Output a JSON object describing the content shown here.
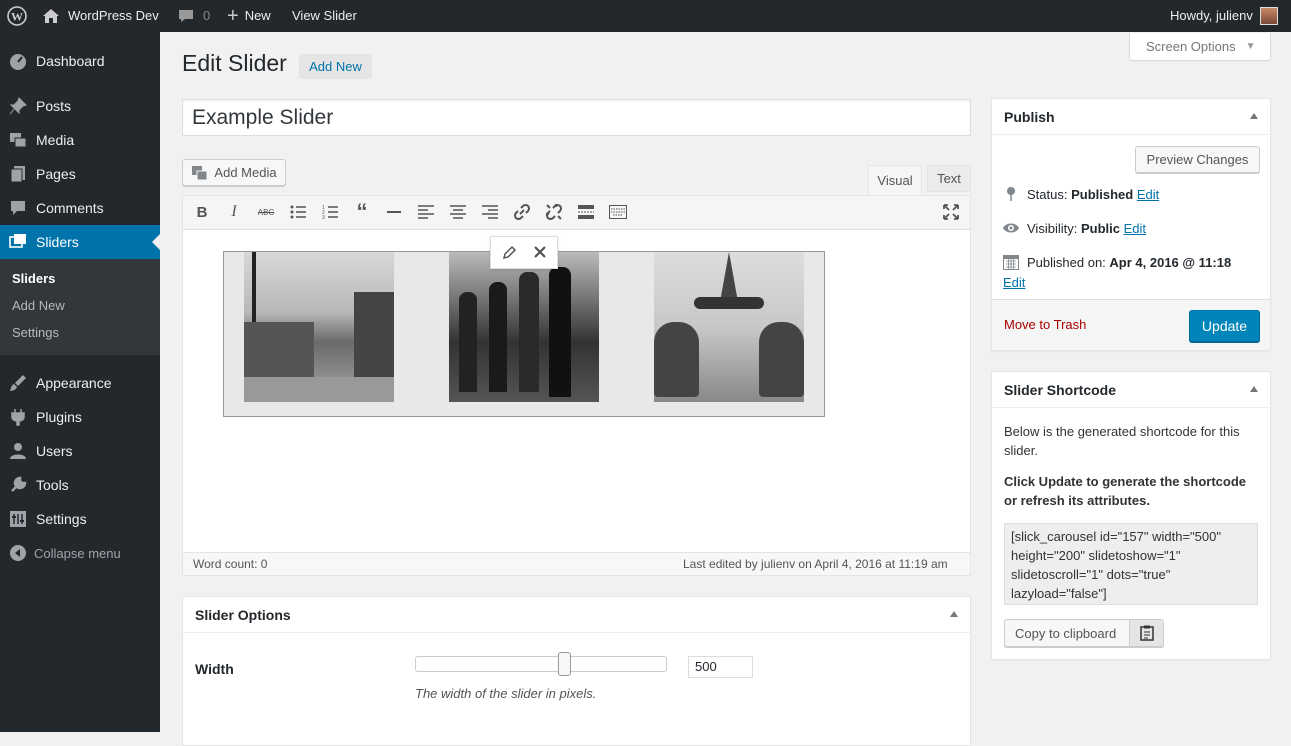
{
  "adminbar": {
    "site_name": "WordPress Dev",
    "comments_count": "0",
    "new_label": "New",
    "view_label": "View Slider",
    "howdy": "Howdy, julienv"
  },
  "sidebar": {
    "items": [
      {
        "label": "Dashboard",
        "icon": "dashboard-icon"
      },
      {
        "label": "Posts",
        "icon": "pin-icon"
      },
      {
        "label": "Media",
        "icon": "media-icon"
      },
      {
        "label": "Pages",
        "icon": "pages-icon"
      },
      {
        "label": "Comments",
        "icon": "comment-icon"
      },
      {
        "label": "Sliders",
        "icon": "slides-icon"
      },
      {
        "label": "Appearance",
        "icon": "brush-icon"
      },
      {
        "label": "Plugins",
        "icon": "plug-icon"
      },
      {
        "label": "Users",
        "icon": "user-icon"
      },
      {
        "label": "Tools",
        "icon": "wrench-icon"
      },
      {
        "label": "Settings",
        "icon": "settings-icon"
      }
    ],
    "submenu": [
      "Sliders",
      "Add New",
      "Settings"
    ],
    "collapse": "Collapse menu"
  },
  "page": {
    "title": "Edit Slider",
    "add_new": "Add New",
    "screen_options": "Screen Options",
    "post_title": "Example Slider"
  },
  "editor": {
    "add_media": "Add Media",
    "tab_visual": "Visual",
    "tab_text": "Text",
    "word_count": "Word count: 0",
    "last_edited": "Last edited by julienv on April 4, 2016 at 11:19 am"
  },
  "publish": {
    "title": "Publish",
    "preview": "Preview Changes",
    "status_label": "Status:",
    "status_value": "Published",
    "visibility_label": "Visibility:",
    "visibility_value": "Public",
    "published_label": "Published on:",
    "published_value": "Apr 4, 2016 @ 11:18",
    "edit": "Edit",
    "trash": "Move to Trash",
    "update": "Update"
  },
  "shortcode": {
    "title": "Slider Shortcode",
    "desc": "Below is the generated shortcode for this slider.",
    "notice": "Click Update to generate the shortcode or refresh its attributes.",
    "code": "[slick_carousel id=\"157\" width=\"500\" height=\"200\" slidetoshow=\"1\" slidetoscroll=\"1\" dots=\"true\" lazyload=\"false\"]",
    "copy": "Copy to clipboard"
  },
  "options": {
    "title": "Slider Options",
    "width_label": "Width",
    "width_value": "500",
    "width_help": "The width of the slider in pixels.",
    "slider_fraction": 0.6
  },
  "colors": {
    "accent": "#0073aa",
    "adminbar": "#23282d",
    "trash": "#a00"
  }
}
